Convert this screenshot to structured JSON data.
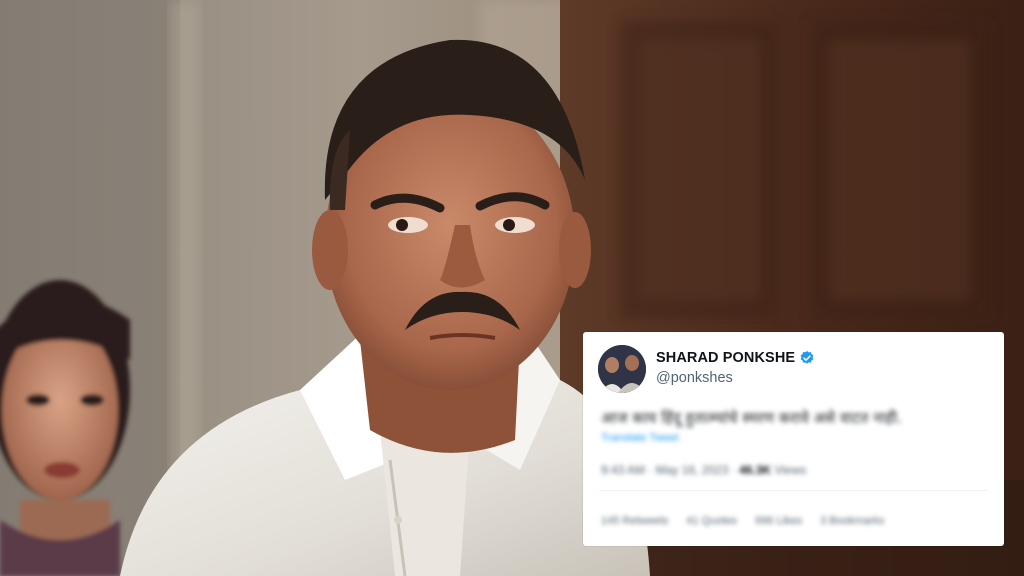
{
  "tweet": {
    "author_name": "SHARAD PONKSHE",
    "author_handle": "@ponkshes",
    "text": "आज काय हिंदू हुतात्म्यांचे स्मरण करावे असे वाटत नाही.",
    "translate_label": "Translate Tweet",
    "time": "9:43 AM · May 16, 2023 · ",
    "views_count": "46.3K",
    "views_label": " Views",
    "retweets": "145 Retweets",
    "quotes": "41 Quotes",
    "likes": "996 Likes",
    "bookmarks": "3 Bookmarks"
  },
  "colors": {
    "verified": "#1d9bf0",
    "card_bg": "#ffffff",
    "name": "#0f1419",
    "muted": "#536471"
  },
  "icons": {
    "verified": "verified-badge-icon"
  }
}
